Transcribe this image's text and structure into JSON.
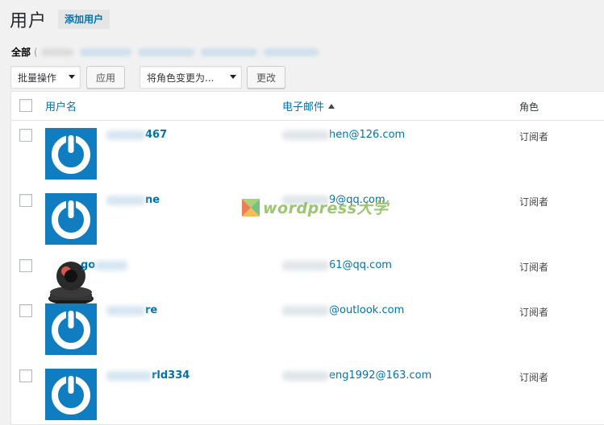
{
  "header": {
    "title": "用户",
    "add_new": "添加用户"
  },
  "filters": {
    "all": "全部",
    "open_paren": "("
  },
  "bulk": {
    "select": "批量操作",
    "apply": "应用"
  },
  "role_change": {
    "select": "将角色变更为...",
    "apply": "更改"
  },
  "columns": {
    "username": "用户名",
    "email": "电子邮件",
    "role": "角色"
  },
  "users": [
    {
      "name_visible": "467",
      "email_visible": "hen@126.com",
      "role": "订阅者"
    },
    {
      "name_visible": "ne",
      "email_visible": "9@qq.com",
      "role": "订阅者"
    },
    {
      "name_visible": "go",
      "email_visible": "61@qq.com",
      "role": "订阅者"
    },
    {
      "name_visible": "re",
      "email_visible": "@outlook.com",
      "role": "订阅者"
    },
    {
      "name_visible": "rld334",
      "email_visible": "eng1992@163.com",
      "role": "订阅者"
    }
  ],
  "watermark": {
    "text": "wordpress大学"
  },
  "colors": {
    "accent": "#0073aa",
    "avatar_bg": "#0f7dbf",
    "watermark": "#7cb342"
  }
}
